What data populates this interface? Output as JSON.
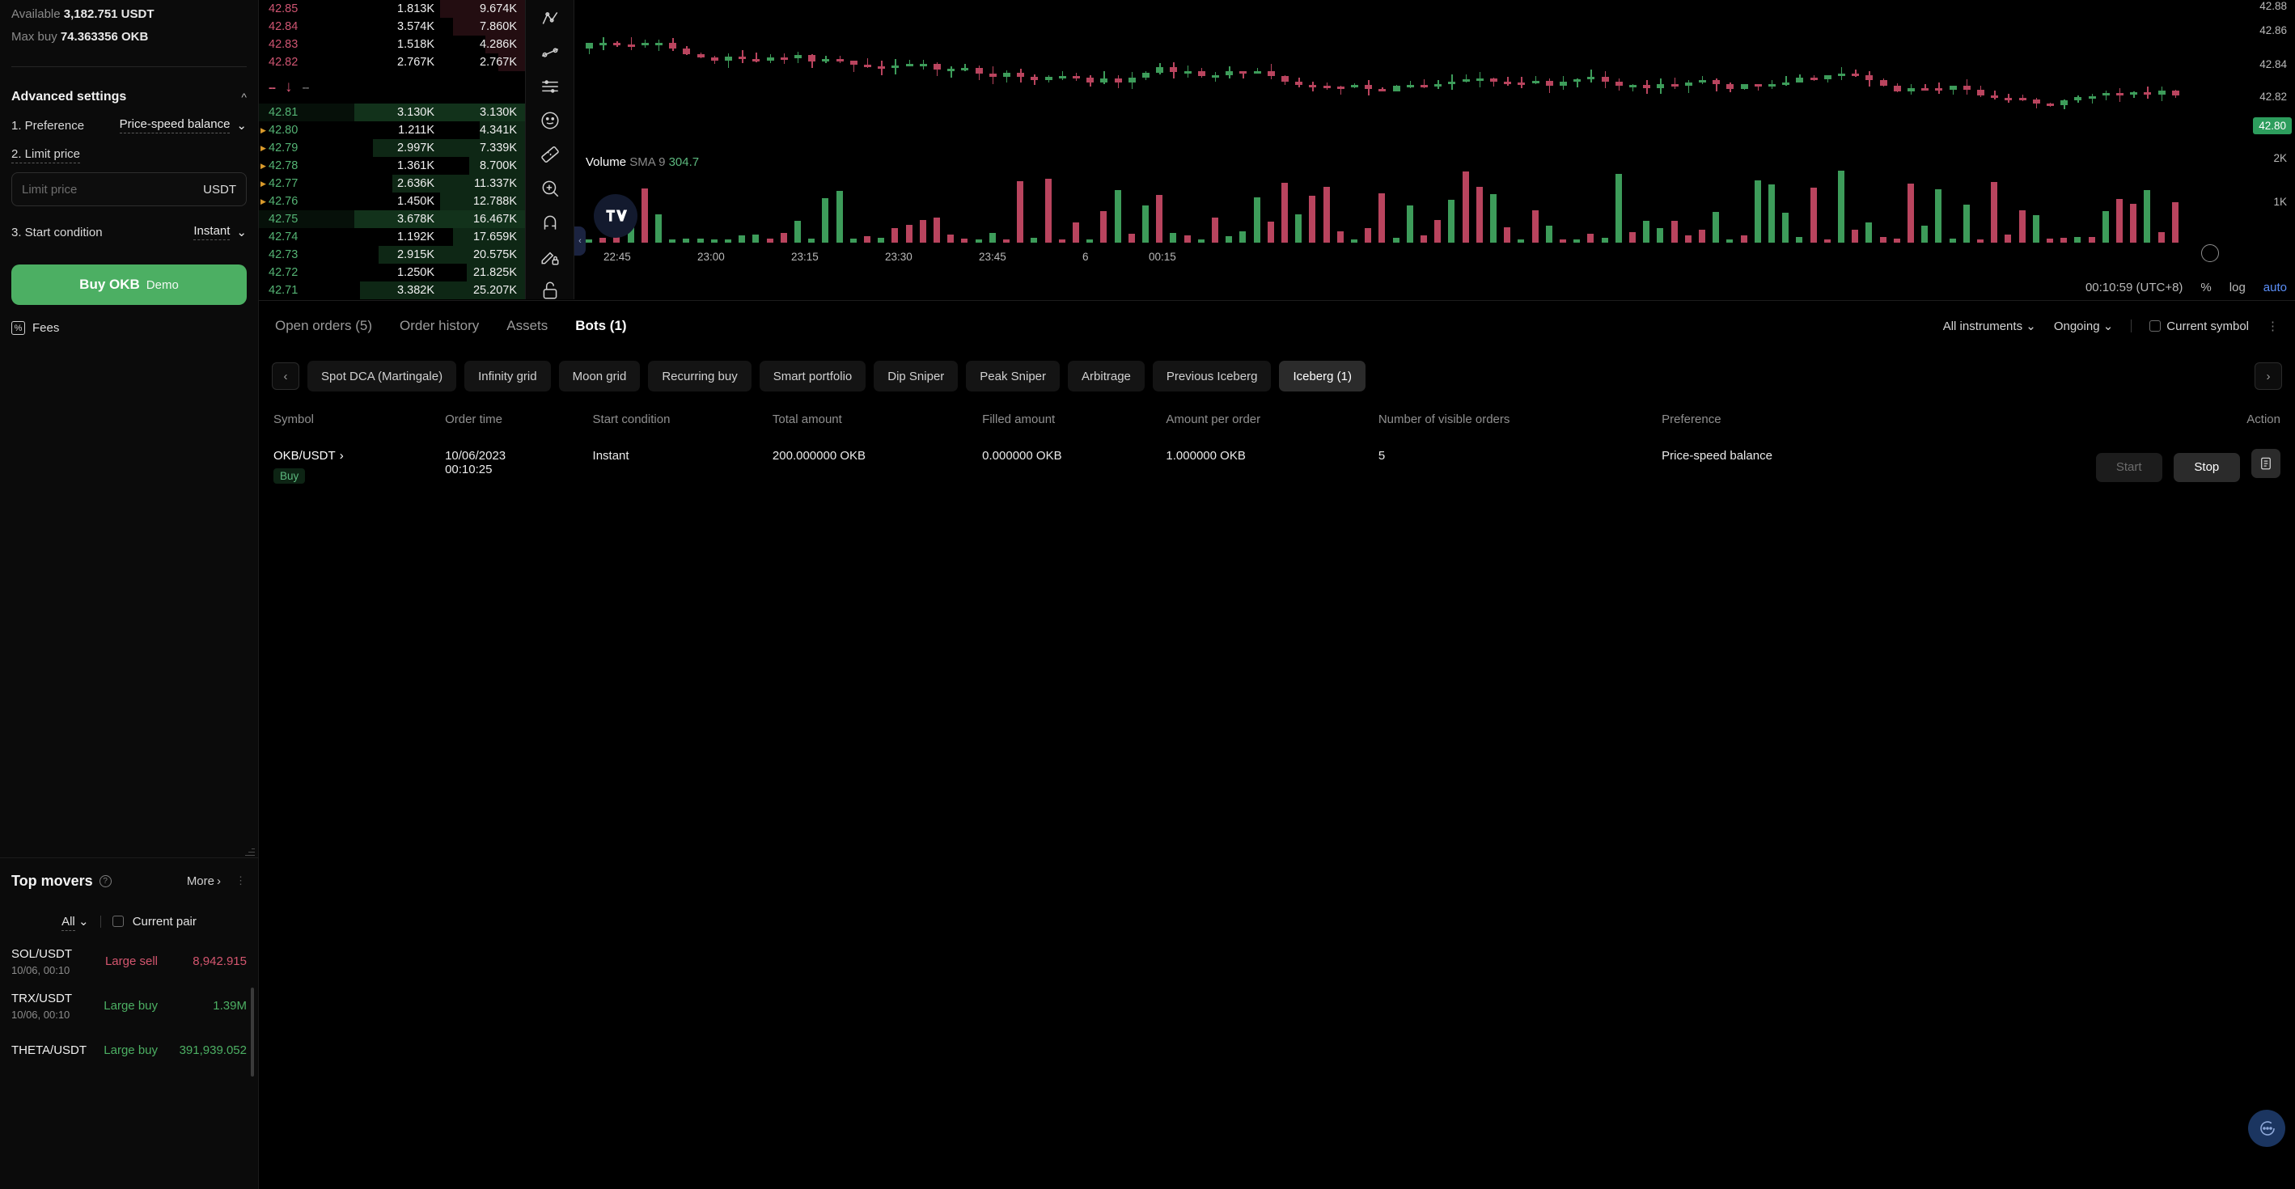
{
  "order_panel": {
    "available_label": "Available",
    "available_value": "3,182.751 USDT",
    "max_buy_label": "Max buy",
    "max_buy_value": "74.363356 OKB",
    "advanced_settings_title": "Advanced settings",
    "collapse_icon": "chevron-up-icon",
    "settings": [
      {
        "label": "1. Preference",
        "value": "Price-speed balance",
        "icon": "chevron-down-icon"
      },
      {
        "label": "3. Start condition",
        "value": "Instant",
        "icon": "chevron-down-icon"
      }
    ],
    "limit_price_label": "2. Limit price",
    "limit_price_placeholder": "Limit price",
    "limit_price_value": "",
    "limit_price_unit": "USDT",
    "buy_button": "Buy OKB",
    "buy_button_demo": "Demo",
    "fees_label": "Fees",
    "fees_icon": "percent-icon"
  },
  "top_movers": {
    "title": "Top movers",
    "help_icon": "question-icon",
    "more": "More",
    "more_icon": "chevron-right-icon",
    "grip_icon": "drag-handle-icon",
    "filter_all": "All",
    "filter_all_icon": "chevron-down-icon",
    "current_pair": "Current pair",
    "rows": [
      {
        "pair": "SOL/USDT",
        "time": "10/06, 00:10",
        "type": "Large sell",
        "dir": "sell",
        "amount": "8,942.915"
      },
      {
        "pair": "TRX/USDT",
        "time": "10/06, 00:10",
        "type": "Large buy",
        "dir": "buy",
        "amount": "1.39M"
      },
      {
        "pair": "THETA/USDT",
        "time": "10/06, 00:10",
        "type": "Large buy",
        "dir": "buy",
        "amount": "391,939.052"
      }
    ]
  },
  "order_book": {
    "asks": [
      {
        "price": "42.85",
        "amount": "1.813K",
        "total": "9.674K",
        "bar": 32
      },
      {
        "price": "42.84",
        "amount": "3.574K",
        "total": "7.860K",
        "bar": 27
      },
      {
        "price": "42.83",
        "amount": "1.518K",
        "total": "4.286K",
        "bar": 15
      },
      {
        "price": "42.82",
        "amount": "2.767K",
        "total": "2.767K",
        "bar": 10
      }
    ],
    "spread": {
      "left": "--",
      "arrow": "arrow-down-icon",
      "right": "--"
    },
    "bids": [
      {
        "price": "42.81",
        "amount": "3.130K",
        "total": "3.130K",
        "bar": 64,
        "flag": false,
        "hl": true
      },
      {
        "price": "42.80",
        "amount": "1.211K",
        "total": "4.341K",
        "bar": 17,
        "flag": true,
        "hl": false
      },
      {
        "price": "42.79",
        "amount": "2.997K",
        "total": "7.339K",
        "bar": 57,
        "flag": true,
        "hl": false
      },
      {
        "price": "42.78",
        "amount": "1.361K",
        "total": "8.700K",
        "bar": 21,
        "flag": true,
        "hl": false
      },
      {
        "price": "42.77",
        "amount": "2.636K",
        "total": "11.337K",
        "bar": 50,
        "flag": true,
        "hl": false
      },
      {
        "price": "42.76",
        "amount": "1.450K",
        "total": "12.788K",
        "bar": 32,
        "flag": true,
        "hl": false
      },
      {
        "price": "42.75",
        "amount": "3.678K",
        "total": "16.467K",
        "bar": 64,
        "flag": false,
        "hl": true
      },
      {
        "price": "42.74",
        "amount": "1.192K",
        "total": "17.659K",
        "bar": 27,
        "flag": false,
        "hl": false
      },
      {
        "price": "42.73",
        "amount": "2.915K",
        "total": "20.575K",
        "bar": 55,
        "flag": false,
        "hl": false
      },
      {
        "price": "42.72",
        "amount": "1.250K",
        "total": "21.825K",
        "bar": 22,
        "flag": false,
        "hl": false
      },
      {
        "price": "42.71",
        "amount": "3.382K",
        "total": "25.207K",
        "bar": 62,
        "flag": false,
        "hl": false
      }
    ]
  },
  "chart_tools": [
    "crosshair-icon",
    "trend-line-icon",
    "fib-icon",
    "emoji-icon",
    "measure-icon",
    "zoom-in-icon",
    "magnet-icon",
    "draw-lock-icon",
    "unlock-icon",
    "eye-icon"
  ],
  "chart": {
    "price_ticks": [
      "42.88",
      "42.86",
      "42.84",
      "42.82"
    ],
    "current_price": "42.80",
    "volume_ticks": [
      "2K",
      "1K"
    ],
    "volume_label": "Volume",
    "volume_sma_label": "SMA 9",
    "volume_sma_value": "304.7",
    "tv_logo": "tradingview-logo-icon",
    "time_ticks": [
      "22:45",
      "23:00",
      "23:15",
      "23:30",
      "23:45",
      "6",
      "00:15"
    ],
    "footer_time": "00:10:59 (UTC+8)",
    "footer_percent": "%",
    "footer_log": "log",
    "footer_auto": "auto",
    "collapse_icon": "chevron-left-icon",
    "crosshair_settings_icon": "target-icon"
  },
  "chart_data": {
    "type": "candlestick",
    "title": "OKB/USDT",
    "price_axis": {
      "ticks": [
        "42.88",
        "42.86",
        "42.84",
        "42.82"
      ],
      "last": "42.80"
    },
    "volume_axis": {
      "ticks": [
        "2K",
        "1K"
      ]
    },
    "time_axis": [
      "22:45",
      "23:00",
      "23:15",
      "23:30",
      "23:45",
      "6",
      "00:15"
    ],
    "volume_sma_period": 9,
    "volume_sma_value": 304.7
  },
  "bottom": {
    "tabs": [
      {
        "label": "Open orders (5)",
        "active": false
      },
      {
        "label": "Order history",
        "active": false
      },
      {
        "label": "Assets",
        "active": false
      },
      {
        "label": "Bots (1)",
        "active": true
      }
    ],
    "instruments_filter": "All instruments",
    "instruments_icon": "chevron-down-icon",
    "status_filter": "Ongoing",
    "status_icon": "chevron-down-icon",
    "current_symbol": "Current symbol",
    "prev_arrow": "chevron-left-icon",
    "next_arrow": "chevron-right-icon",
    "strategies": [
      {
        "label": "Spot DCA (Martingale)",
        "active": false
      },
      {
        "label": "Infinity grid",
        "active": false
      },
      {
        "label": "Moon grid",
        "active": false
      },
      {
        "label": "Recurring buy",
        "active": false
      },
      {
        "label": "Smart portfolio",
        "active": false
      },
      {
        "label": "Dip Sniper",
        "active": false
      },
      {
        "label": "Peak Sniper",
        "active": false
      },
      {
        "label": "Arbitrage",
        "active": false
      },
      {
        "label": "Previous Iceberg",
        "active": false
      },
      {
        "label": "Iceberg (1)",
        "active": true
      }
    ],
    "table": {
      "columns": [
        "Symbol",
        "Order time",
        "Start condition",
        "Total amount",
        "Filled amount",
        "Amount per order",
        "Number of visible orders",
        "Preference",
        "Action"
      ],
      "rows": [
        {
          "symbol": "OKB/USDT",
          "symbol_icon": "chevron-right-icon",
          "side": "Buy",
          "order_time_line1": "10/06/2023",
          "order_time_line2": "00:10:25",
          "start_condition": "Instant",
          "total_amount": "200.000000 OKB",
          "filled_amount": "0.000000 OKB",
          "amount_per_order": "1.000000 OKB",
          "visible_orders": "5",
          "preference": "Price-speed balance",
          "start_button": "Start",
          "stop_button": "Stop",
          "details_icon": "document-icon"
        }
      ]
    },
    "chat_icon": "chat-bubble-icon"
  },
  "colors": {
    "buy_green": "#4caf63",
    "sell_red": "#cf5572",
    "accent_blue": "#5b8ff9"
  }
}
